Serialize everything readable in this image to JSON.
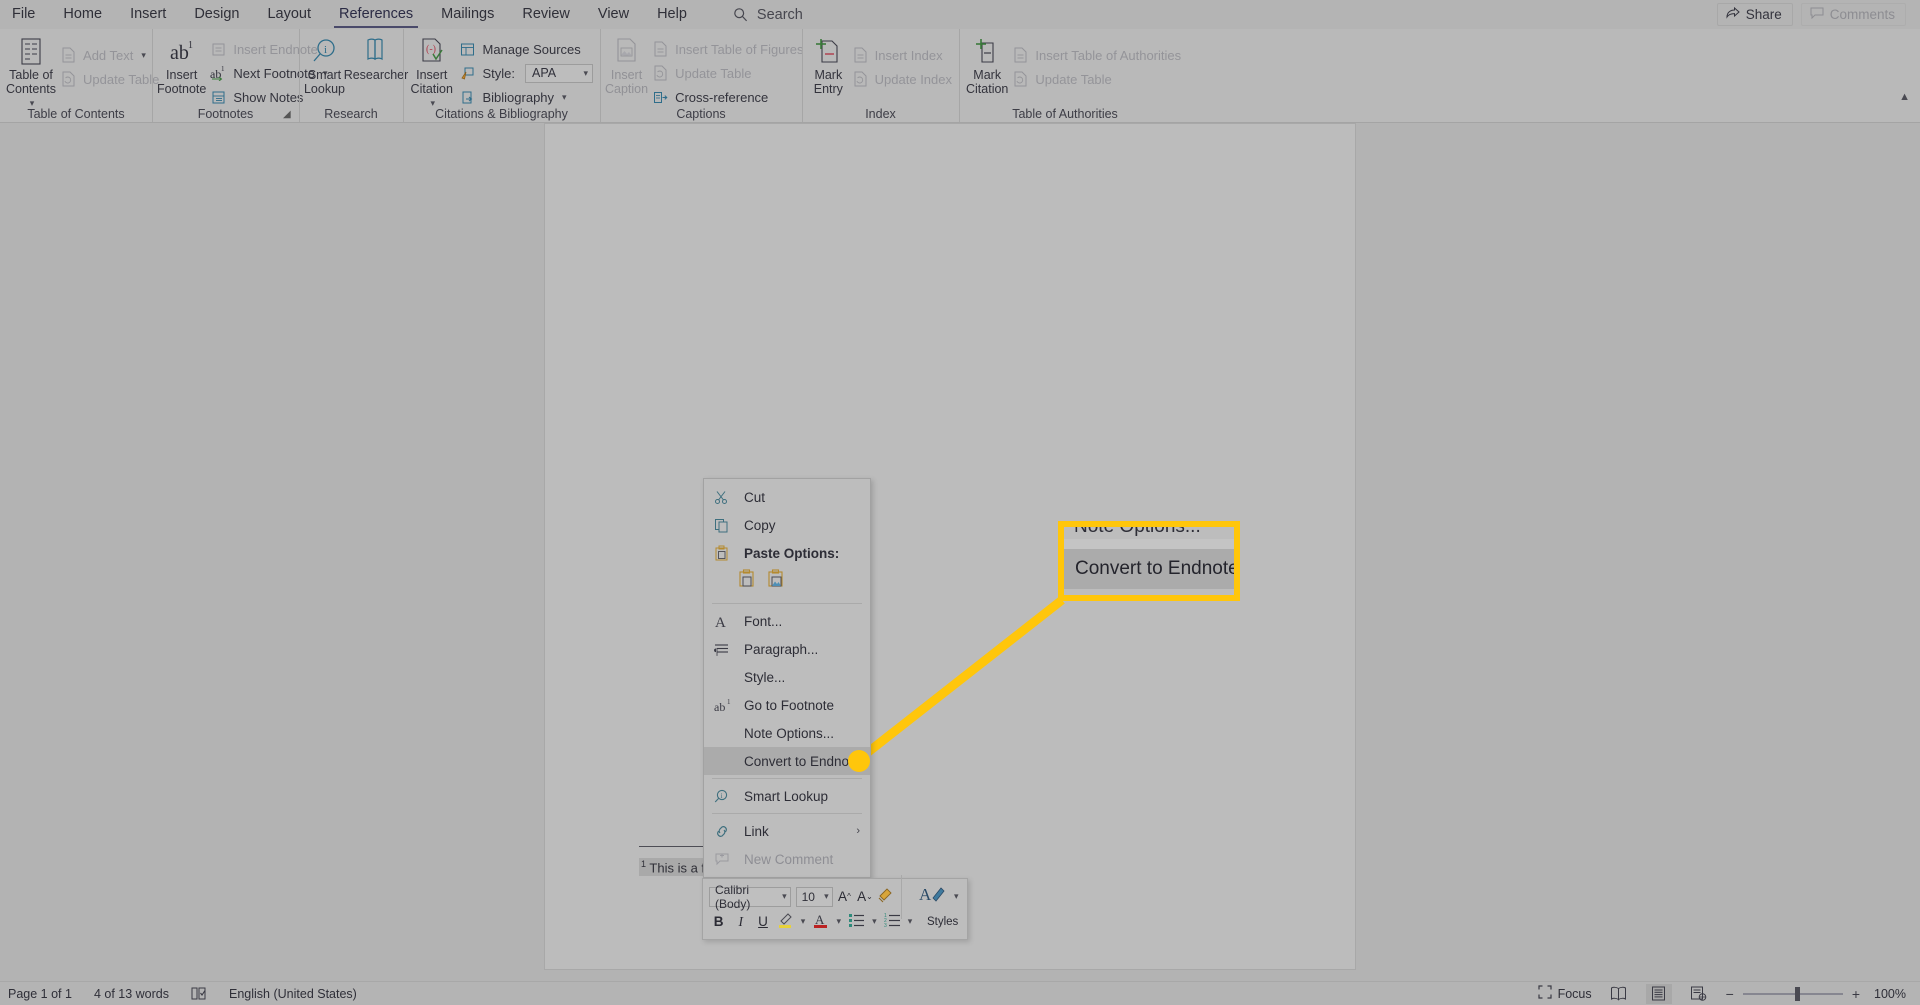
{
  "window": {
    "tabs": [
      {
        "label": "File",
        "active": false
      },
      {
        "label": "Home",
        "active": false
      },
      {
        "label": "Insert",
        "active": false
      },
      {
        "label": "Design",
        "active": false
      },
      {
        "label": "Layout",
        "active": false
      },
      {
        "label": "References",
        "active": true
      },
      {
        "label": "Mailings",
        "active": false
      },
      {
        "label": "Review",
        "active": false
      },
      {
        "label": "View",
        "active": false
      },
      {
        "label": "Help",
        "active": false
      }
    ],
    "search_label": "Search",
    "share_label": "Share",
    "comments_label": "Comments"
  },
  "ribbon": {
    "groups": [
      {
        "label": "Table of Contents",
        "big": {
          "label": "Table of\nContents",
          "icon": "toc-icon",
          "has_caret": true
        },
        "small": [
          {
            "label": "Add Text",
            "icon": "add-text-icon",
            "dim": true,
            "has_caret": true
          },
          {
            "label": "Update Table",
            "icon": "update-table-icon",
            "dim": true,
            "has_caret": false
          }
        ]
      },
      {
        "label": "Footnotes",
        "big": {
          "label": "Insert\nFootnote",
          "icon": "insert-footnote-icon",
          "has_caret": false
        },
        "small": [
          {
            "label": "Insert Endnote",
            "icon": "insert-endnote-icon",
            "dim": true,
            "has_caret": false
          },
          {
            "label": "Next Footnote",
            "icon": "next-footnote-icon",
            "dim": false,
            "has_caret": true
          },
          {
            "label": "Show Notes",
            "icon": "show-notes-icon",
            "dim": false,
            "has_caret": false
          }
        ],
        "dialog_launcher": true
      },
      {
        "label": "Research",
        "buttons": [
          {
            "label": "Smart\nLookup",
            "icon": "smart-lookup-icon"
          },
          {
            "label": "Researcher",
            "icon": "researcher-icon"
          }
        ]
      },
      {
        "label": "Citations & Bibliography",
        "big": {
          "label": "Insert\nCitation",
          "icon": "insert-citation-icon",
          "has_caret": true
        },
        "small": [
          {
            "label": "Manage Sources",
            "icon": "manage-sources-icon",
            "dim": false,
            "has_caret": false
          },
          {
            "label": "Style:",
            "icon": "style-icon",
            "dim": false,
            "select_value": "APA"
          },
          {
            "label": "Bibliography",
            "icon": "bibliography-icon",
            "dim": false,
            "has_caret": true
          }
        ]
      },
      {
        "label": "Captions",
        "big": {
          "label": "Insert\nCaption",
          "icon": "insert-caption-icon",
          "dim": true,
          "has_caret": false
        },
        "small": [
          {
            "label": "Insert Table of Figures",
            "icon": "insert-table-figures-icon",
            "dim": true,
            "has_caret": false
          },
          {
            "label": "Update Table",
            "icon": "update-table-icon",
            "dim": true,
            "has_caret": false
          },
          {
            "label": "Cross-reference",
            "icon": "cross-reference-icon",
            "dim": false,
            "has_caret": false
          }
        ]
      },
      {
        "label": "Index",
        "big": {
          "label": "Mark\nEntry",
          "icon": "mark-entry-icon",
          "has_caret": false
        },
        "small": [
          {
            "label": "Insert Index",
            "icon": "insert-index-icon",
            "dim": true,
            "has_caret": false
          },
          {
            "label": "Update Index",
            "icon": "update-index-icon",
            "dim": true,
            "has_caret": false
          }
        ]
      },
      {
        "label": "Table of Authorities",
        "big": {
          "label": "Mark\nCitation",
          "icon": "mark-citation-icon",
          "has_caret": false
        },
        "small": [
          {
            "label": "Insert Table of Authorities",
            "icon": "insert-table-authorities-icon",
            "dim": true,
            "has_caret": false
          },
          {
            "label": "Update Table",
            "icon": "update-table-icon",
            "dim": true,
            "has_caret": false
          }
        ]
      }
    ]
  },
  "document": {
    "footnote_text": "This is a footnote.",
    "footnote_marker": "1"
  },
  "context_menu": {
    "items": [
      {
        "label": "Cut",
        "icon": "scissors-icon",
        "accel_index": 2,
        "type": "item"
      },
      {
        "label": "Copy",
        "icon": "copy-icon",
        "accel_index": 0,
        "type": "item"
      },
      {
        "label": "Paste Options:",
        "icon": "paste-icon",
        "type": "header"
      },
      {
        "type": "paste-row",
        "options": [
          "keep-source-formatting-icon",
          "picture-icon"
        ]
      },
      {
        "type": "separator"
      },
      {
        "label": "Font...",
        "icon": "font-a-icon",
        "accel_index": 0,
        "type": "item"
      },
      {
        "label": "Paragraph...",
        "icon": "paragraph-icon",
        "accel_index": 0,
        "type": "item"
      },
      {
        "label": "Style...",
        "icon": "",
        "accel_index": 1,
        "type": "item"
      },
      {
        "label": "Go to Footnote",
        "icon": "ab-footnote-icon",
        "accel_index": 0,
        "type": "item"
      },
      {
        "label": "Note Options...",
        "icon": "",
        "accel_index": 0,
        "type": "item"
      },
      {
        "label": "Convert to Endnote",
        "icon": "",
        "accel_index": 5,
        "type": "item",
        "highlighted": true
      },
      {
        "type": "separator"
      },
      {
        "label": "Smart Lookup",
        "icon": "smart-lookup-small-icon",
        "accel_index": 6,
        "type": "item"
      },
      {
        "type": "separator"
      },
      {
        "label": "Link",
        "icon": "link-icon",
        "accel_index": 0,
        "type": "item",
        "submenu": true
      },
      {
        "label": "New Comment",
        "icon": "new-comment-icon",
        "accel_index": 6,
        "type": "item",
        "dim": true
      }
    ]
  },
  "callout": {
    "top_label": "Note Options...",
    "highlight_label": "Convert to Endnote",
    "accent_color": "#ffc60b"
  },
  "mini_toolbar": {
    "font_name": "Calibri (Body)",
    "font_size": "10",
    "grow_font": "A",
    "shrink_font": "A",
    "format_painter": "format-painter-icon",
    "styles_label": "Styles",
    "bold": "B",
    "italic": "I",
    "underline": "U",
    "highlight": "highlight-icon",
    "font_color": "A",
    "bullets": "bullets-icon",
    "numbering": "numbering-icon"
  },
  "status_bar": {
    "page": "Page 1 of 1",
    "words": "4 of 13 words",
    "proofing_icon": "proofing-icon",
    "language": "English (United States)",
    "focus_label": "Focus",
    "views": [
      "read-mode-icon",
      "print-layout-icon",
      "web-layout-icon"
    ],
    "selected_view_index": 1,
    "zoom_out": "−",
    "zoom_in": "+",
    "zoom_level": "100%"
  }
}
